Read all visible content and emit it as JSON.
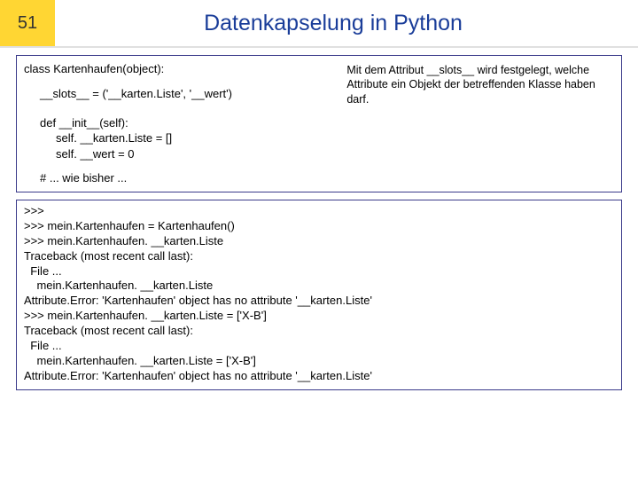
{
  "header": {
    "slide_number": "51",
    "title": "Datenkapselung in Python"
  },
  "code": {
    "l1": "class Kartenhaufen(object):",
    "l2": "__slots__ = ('__karten.Liste', '__wert')",
    "l3": "def __init__(self):",
    "l4": "self. __karten.Liste = []",
    "l5": "self. __wert = 0",
    "l6": "# ... wie bisher ..."
  },
  "annotation": {
    "text": "Mit dem Attribut __slots__ wird festgelegt, welche Attribute ein Objekt der betreffenden Klasse haben darf."
  },
  "console": {
    "l1": ">>>",
    "l2": ">>> mein.Kartenhaufen = Kartenhaufen()",
    "l3": ">>> mein.Kartenhaufen. __karten.Liste",
    "l4": "Traceback (most recent call last):",
    "l5": "  File ...",
    "l6": "    mein.Kartenhaufen. __karten.Liste",
    "l7": "Attribute.Error: 'Kartenhaufen' object has no attribute '__karten.Liste'",
    "l8": ">>> mein.Kartenhaufen. __karten.Liste = ['X-B']",
    "l9": "Traceback (most recent call last):",
    "l10": "  File ...",
    "l11": "    mein.Kartenhaufen. __karten.Liste = ['X-B']",
    "l12": "Attribute.Error: 'Kartenhaufen' object has no attribute '__karten.Liste'"
  }
}
